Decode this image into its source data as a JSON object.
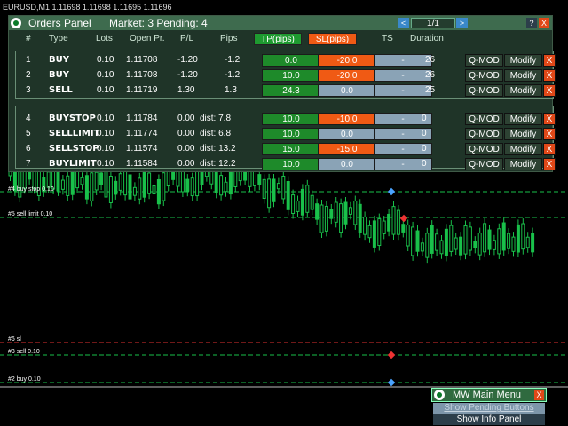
{
  "symbol_line": "EURUSD,M1  1.11698 1.11698 1.11695 1.11696",
  "panel": {
    "title": "Orders Panel",
    "market": "Market: 3 Pending: 4",
    "page": "1/1",
    "prev": "<",
    "next": ">",
    "help": "?",
    "close": "X",
    "headers": {
      "num": "#",
      "type": "Type",
      "lots": "Lots",
      "open": "Open Pr.",
      "pl": "P/L",
      "pips": "Pips",
      "tp": "TP(pips)",
      "sl": "SL(pips)",
      "ts": "TS",
      "duration": "Duration"
    },
    "market_rows": [
      {
        "num": "1",
        "type": "BUY",
        "lots": "0.10",
        "open": "1.11708",
        "pl": "-1.20",
        "pips": "-1.2",
        "tp": "0.0",
        "sl": "-20.0",
        "ts": "-",
        "duration": "26",
        "qmod": "Q-MOD",
        "modify": "Modify",
        "x": "X"
      },
      {
        "num": "2",
        "type": "BUY",
        "lots": "0.10",
        "open": "1.11708",
        "pl": "-1.20",
        "pips": "-1.2",
        "tp": "10.0",
        "sl": "-20.0",
        "ts": "-",
        "duration": "26",
        "qmod": "Q-MOD",
        "modify": "Modify",
        "x": "X"
      },
      {
        "num": "3",
        "type": "SELL",
        "lots": "0.10",
        "open": "1.11719",
        "pl": "1.30",
        "pips": "1.3",
        "tp": "24.3",
        "sl": "0.0",
        "ts": "-",
        "duration": "25",
        "qmod": "Q-MOD",
        "modify": "Modify",
        "x": "X"
      }
    ],
    "pending_rows": [
      {
        "num": "4",
        "type": "BUYSTOP",
        "lots": "0.10",
        "open": "1.11784",
        "pl": "0.00",
        "pips": "dist: 7.8",
        "tp": "10.0",
        "sl": "-10.0",
        "ts": "-",
        "duration": "0",
        "qmod": "Q-MOD",
        "modify": "Modify",
        "x": "X"
      },
      {
        "num": "5",
        "type": "SELLLIMIT",
        "lots": "0.10",
        "open": "1.11774",
        "pl": "0.00",
        "pips": "dist: 6.8",
        "tp": "10.0",
        "sl": "0.0",
        "ts": "-",
        "duration": "0",
        "qmod": "Q-MOD",
        "modify": "Modify",
        "x": "X"
      },
      {
        "num": "6",
        "type": "SELLSTOP",
        "lots": "0.10",
        "open": "1.11574",
        "pl": "0.00",
        "pips": "dist: 13.2",
        "tp": "15.0",
        "sl": "-15.0",
        "ts": "-",
        "duration": "0",
        "qmod": "Q-MOD",
        "modify": "Modify",
        "x": "X"
      },
      {
        "num": "7",
        "type": "BUYLIMIT",
        "lots": "0.10",
        "open": "1.11584",
        "pl": "0.00",
        "pips": "dist: 12.2",
        "tp": "10.0",
        "sl": "0.0",
        "ts": "-",
        "duration": "0",
        "qmod": "Q-MOD",
        "modify": "Modify",
        "x": "X"
      }
    ]
  },
  "levels": [
    {
      "label": "#4 buy stop 0.10",
      "color": "#19c04a"
    },
    {
      "label": "#5 sell limit 0.10",
      "color": "#19c04a"
    },
    {
      "label": "#6 sl",
      "color": "#e03030"
    },
    {
      "label": "#3 sell 0.10",
      "color": "#19c04a"
    },
    {
      "label": "#2 buy 0.10",
      "color": "#19c04a"
    }
  ],
  "mw_menu": {
    "title": "MW Main Menu",
    "close": "X",
    "show_pending": "Show Pending Buttons",
    "show_info": "Show Info Panel"
  },
  "colors": {
    "candle": "#19c04a",
    "tp_green": "#1e8a2a",
    "sl_red": "#f05a14",
    "neutral": "#8aa3b6"
  }
}
